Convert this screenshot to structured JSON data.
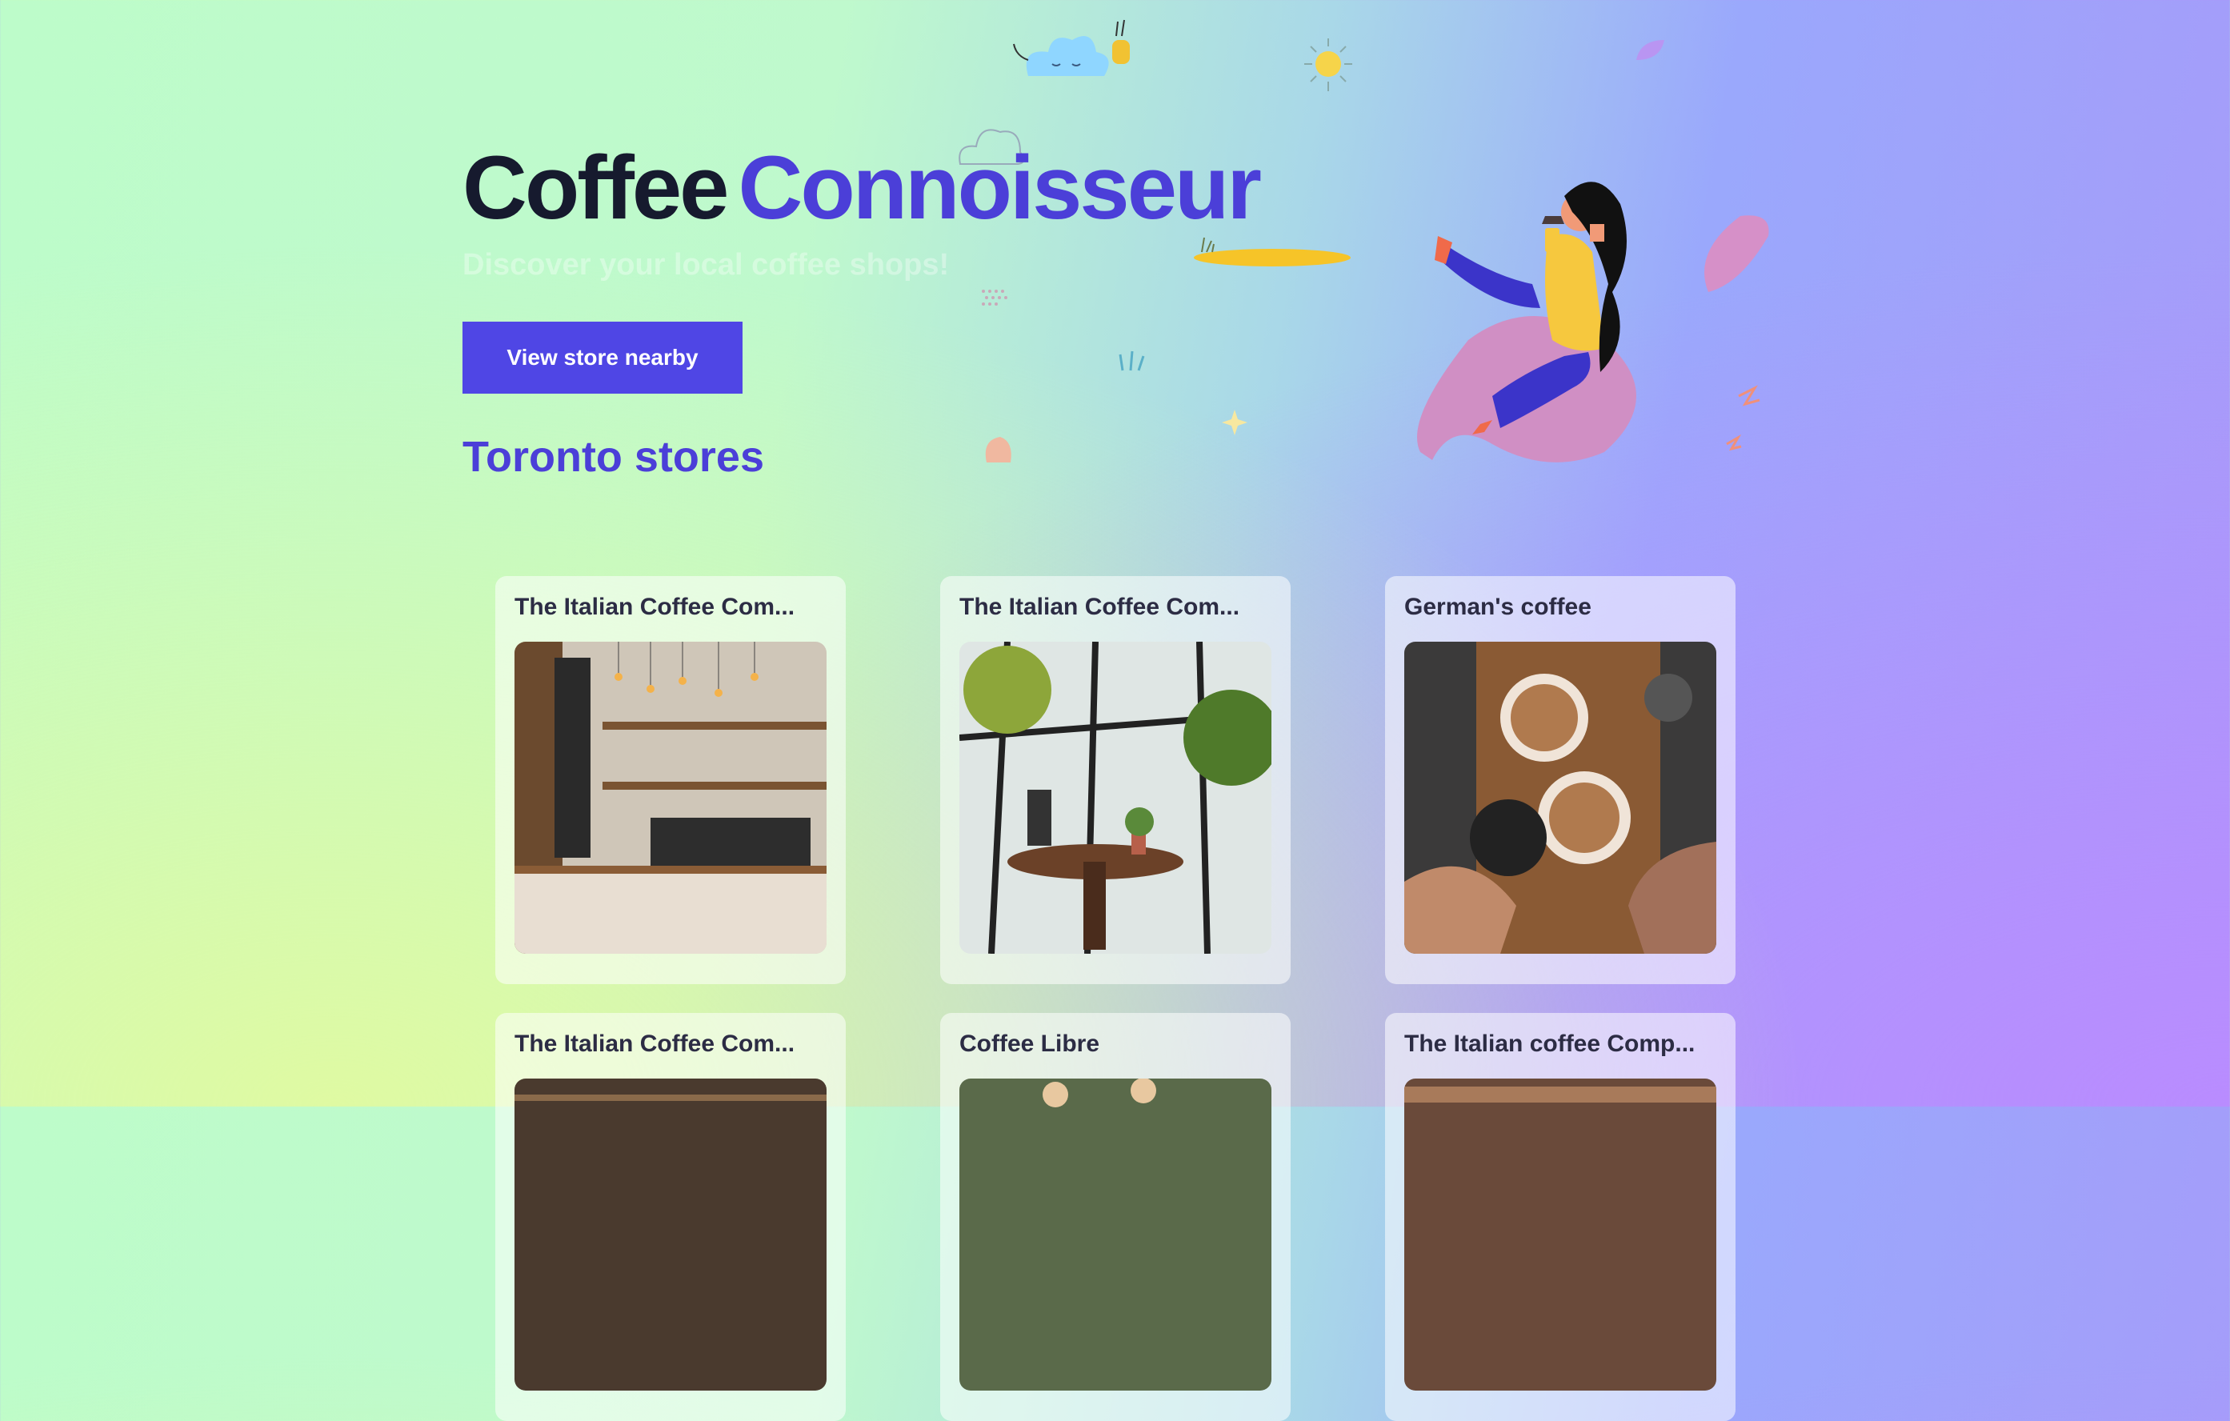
{
  "hero": {
    "title_part1": "Coffee",
    "title_part2": "Connoisseur",
    "subtitle": "Discover your local coffee shops!",
    "cta_label": "View store nearby"
  },
  "section": {
    "title": "Toronto stores"
  },
  "stores": [
    {
      "name": "The Italian Coffee Com...",
      "photo": "cafe-counter-photo"
    },
    {
      "name": "The Italian Coffee Com...",
      "photo": "cafe-window-table-photo"
    },
    {
      "name": "German's coffee",
      "photo": "latte-cheers-photo"
    },
    {
      "name": "The Italian Coffee Com...",
      "photo": "cafe-interior-photo"
    },
    {
      "name": "Coffee Libre",
      "photo": "cafe-ceiling-photo"
    },
    {
      "name": "The Italian coffee Comp...",
      "photo": "cafe-bar-photo"
    }
  ],
  "colors": {
    "accent": "#4f46e5",
    "title_dark": "#161a2e",
    "title_accent": "#4b3fd8",
    "card_text": "#2c2c44"
  }
}
